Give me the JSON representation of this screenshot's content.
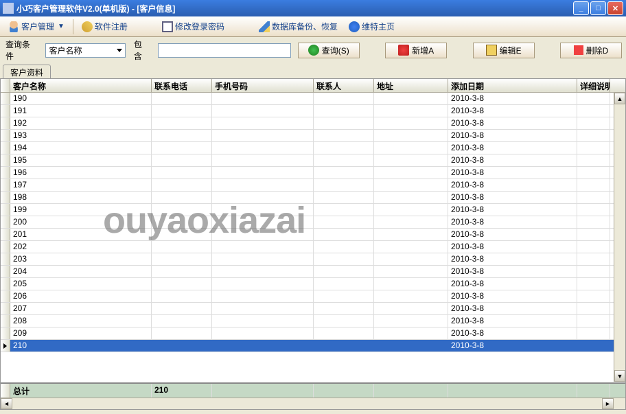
{
  "window": {
    "title": "小巧客户管理软件V2.0(单机版) - [客户信息]"
  },
  "toolbar": {
    "customer_mgmt": "客户管理",
    "register": "软件注册",
    "change_pwd": "修改登录密码",
    "backup": "数据库备份、恢复",
    "homepage": "维特主页"
  },
  "search": {
    "label_condition": "查询条件",
    "combo_value": "客户名称",
    "label_contains": "包含",
    "input_value": "",
    "btn_query": "查询(S)",
    "btn_add": "新增A",
    "btn_edit": "编辑E",
    "btn_delete": "删除D"
  },
  "tab": {
    "label": "客户资料"
  },
  "grid": {
    "columns": [
      "客户名称",
      "联系电话",
      "手机号码",
      "联系人",
      "地址",
      "添加日期",
      "详细说明"
    ],
    "rows": [
      {
        "name": "190",
        "phone": "",
        "mobile": "",
        "contact": "",
        "addr": "",
        "date": "2010-3-8",
        "detail": ""
      },
      {
        "name": "191",
        "phone": "",
        "mobile": "",
        "contact": "",
        "addr": "",
        "date": "2010-3-8",
        "detail": ""
      },
      {
        "name": "192",
        "phone": "",
        "mobile": "",
        "contact": "",
        "addr": "",
        "date": "2010-3-8",
        "detail": ""
      },
      {
        "name": "193",
        "phone": "",
        "mobile": "",
        "contact": "",
        "addr": "",
        "date": "2010-3-8",
        "detail": ""
      },
      {
        "name": "194",
        "phone": "",
        "mobile": "",
        "contact": "",
        "addr": "",
        "date": "2010-3-8",
        "detail": ""
      },
      {
        "name": "195",
        "phone": "",
        "mobile": "",
        "contact": "",
        "addr": "",
        "date": "2010-3-8",
        "detail": ""
      },
      {
        "name": "196",
        "phone": "",
        "mobile": "",
        "contact": "",
        "addr": "",
        "date": "2010-3-8",
        "detail": ""
      },
      {
        "name": "197",
        "phone": "",
        "mobile": "",
        "contact": "",
        "addr": "",
        "date": "2010-3-8",
        "detail": ""
      },
      {
        "name": "198",
        "phone": "",
        "mobile": "",
        "contact": "",
        "addr": "",
        "date": "2010-3-8",
        "detail": ""
      },
      {
        "name": "199",
        "phone": "",
        "mobile": "",
        "contact": "",
        "addr": "",
        "date": "2010-3-8",
        "detail": ""
      },
      {
        "name": "200",
        "phone": "",
        "mobile": "",
        "contact": "",
        "addr": "",
        "date": "2010-3-8",
        "detail": ""
      },
      {
        "name": "201",
        "phone": "",
        "mobile": "",
        "contact": "",
        "addr": "",
        "date": "2010-3-8",
        "detail": ""
      },
      {
        "name": "202",
        "phone": "",
        "mobile": "",
        "contact": "",
        "addr": "",
        "date": "2010-3-8",
        "detail": ""
      },
      {
        "name": "203",
        "phone": "",
        "mobile": "",
        "contact": "",
        "addr": "",
        "date": "2010-3-8",
        "detail": ""
      },
      {
        "name": "204",
        "phone": "",
        "mobile": "",
        "contact": "",
        "addr": "",
        "date": "2010-3-8",
        "detail": ""
      },
      {
        "name": "205",
        "phone": "",
        "mobile": "",
        "contact": "",
        "addr": "",
        "date": "2010-3-8",
        "detail": ""
      },
      {
        "name": "206",
        "phone": "",
        "mobile": "",
        "contact": "",
        "addr": "",
        "date": "2010-3-8",
        "detail": ""
      },
      {
        "name": "207",
        "phone": "",
        "mobile": "",
        "contact": "",
        "addr": "",
        "date": "2010-3-8",
        "detail": ""
      },
      {
        "name": "208",
        "phone": "",
        "mobile": "",
        "contact": "",
        "addr": "",
        "date": "2010-3-8",
        "detail": ""
      },
      {
        "name": "209",
        "phone": "",
        "mobile": "",
        "contact": "",
        "addr": "",
        "date": "2010-3-8",
        "detail": ""
      },
      {
        "name": "210",
        "phone": "",
        "mobile": "",
        "contact": "",
        "addr": "",
        "date": "2010-3-8",
        "detail": ""
      }
    ],
    "selected_index": 20,
    "footer": {
      "label": "总计",
      "count": "210"
    }
  },
  "watermark": "ouyaoxiazai"
}
